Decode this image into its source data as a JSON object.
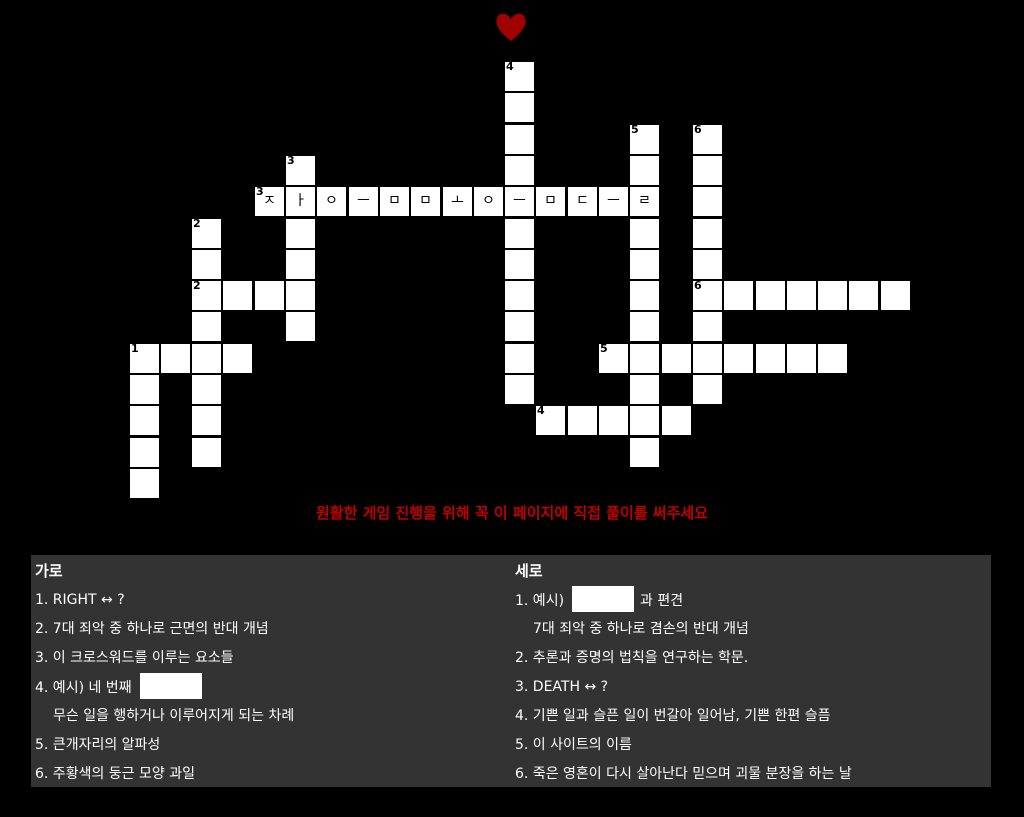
{
  "heart_icon": "heart-icon",
  "notice": "원활한 게임 진행을 위해 꼭 이 페이지에 직접 풀이를 써주세요",
  "grid": {
    "cell_numbers": [
      {
        "r": 2,
        "c": 16,
        "n": "4"
      },
      {
        "r": 4,
        "c": 20,
        "n": "5"
      },
      {
        "r": 4,
        "c": 22,
        "n": "6"
      },
      {
        "r": 5,
        "c": 9,
        "n": "3"
      },
      {
        "r": 6,
        "c": 8,
        "n": "3"
      },
      {
        "r": 7,
        "c": 6,
        "n": "2"
      },
      {
        "r": 9,
        "c": 6,
        "n": "2"
      },
      {
        "r": 9,
        "c": 22,
        "n": "6"
      },
      {
        "r": 11,
        "c": 4,
        "n": "1"
      },
      {
        "r": 11,
        "c": 19,
        "n": "5"
      },
      {
        "r": 13,
        "c": 17,
        "n": "4"
      }
    ],
    "row3_letters": [
      "ㅈ",
      "ㅏ",
      "ㅇ",
      "ㅡ",
      "ㅁ",
      "ㅁ",
      "ㅗ",
      "ㅇ",
      "ㅡ",
      "ㅁ",
      "ㄷ",
      "ㅡ",
      "ㄹ"
    ]
  },
  "clues": {
    "across": {
      "heading": "가로",
      "items": [
        "1. RIGHT ↔ ?",
        "2. 7대 죄악 중 하나로 근면의 반대 개념",
        "3. 이 크로스워드를 이루는 요소들",
        "4. 예시) 네 번째",
        "무슨 일을 행하거나 이루어지게 되는 차례",
        "5. 큰개자리의 알파성",
        "6. 주황색의 둥근 모양 과일"
      ]
    },
    "down": {
      "heading": "세로",
      "items": [
        "1. 예시)",
        "과 편견",
        "7대 죄악 중 하나로 겸손의 반대 개념",
        "2. 추론과 증명의 법칙을 연구하는 학문.",
        "3. DEATH ↔ ?",
        "4. 기쁜 일과 슬픈 일이 번갈아 일어남, 기쁜 한편 슬픔",
        "5. 이 사이트의 이름",
        "6. 죽은 영혼이 다시 살아난다 믿으며 괴물 분장을 하는 날"
      ]
    }
  }
}
